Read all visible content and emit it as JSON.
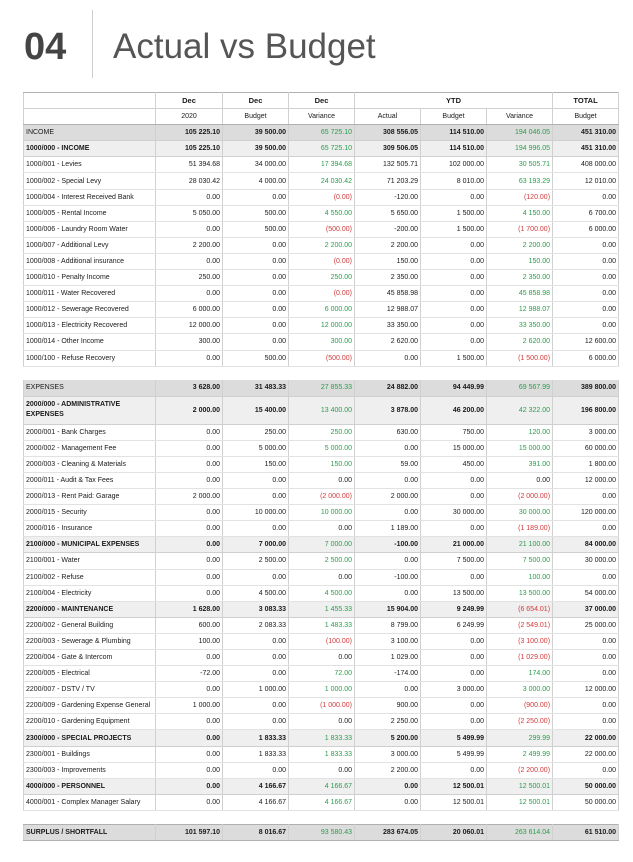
{
  "page": {
    "number": "04",
    "title": "Actual vs Budget"
  },
  "headers": {
    "top": [
      "",
      "Dec",
      "Dec",
      "Dec",
      "YTD",
      "TOTAL"
    ],
    "sub": [
      "",
      "2020",
      "Budget",
      "Variance",
      "Actual",
      "Budget",
      "Variance",
      "Budget"
    ]
  },
  "colors": {
    "positive_variance": "#2a9d4b",
    "negative_variance": "#d23a3a",
    "section_bg": "#dcdcdc"
  },
  "rows": [
    {
      "type": "section",
      "label": "INCOME",
      "v": [
        "105 225.10",
        "39 500.00",
        "65 725.10",
        "308 556.05",
        "114 510.00",
        "194 046.05",
        "451 310.00"
      ],
      "s": [
        "",
        "",
        "pos",
        "",
        "",
        "pos",
        ""
      ]
    },
    {
      "type": "group",
      "label": "1000/000 - INCOME",
      "v": [
        "105 225.10",
        "39 500.00",
        "65 725.10",
        "309 506.05",
        "114 510.00",
        "194 996.05",
        "451 310.00"
      ],
      "s": [
        "",
        "",
        "pos",
        "",
        "",
        "pos",
        ""
      ]
    },
    {
      "type": "line",
      "label": "1000/001 - Levies",
      "v": [
        "51 394.68",
        "34 000.00",
        "17 394.68",
        "132 505.71",
        "102 000.00",
        "30 505.71",
        "408 000.00"
      ],
      "s": [
        "",
        "",
        "pos",
        "",
        "",
        "pos",
        ""
      ]
    },
    {
      "type": "line",
      "label": "1000/002 - Special Levy",
      "v": [
        "28 030.42",
        "4 000.00",
        "24 030.42",
        "71 203.29",
        "8 010.00",
        "63 193.29",
        "12 010.00"
      ],
      "s": [
        "",
        "",
        "pos",
        "",
        "",
        "pos",
        ""
      ]
    },
    {
      "type": "line",
      "label": "1000/004 - Interest Received Bank",
      "v": [
        "0.00",
        "0.00",
        "(0.00)",
        "-120.00",
        "0.00",
        "(120.00)",
        "0.00"
      ],
      "s": [
        "",
        "",
        "neg",
        "",
        "",
        "neg",
        ""
      ]
    },
    {
      "type": "line",
      "label": "1000/005 - Rental Income",
      "v": [
        "5 050.00",
        "500.00",
        "4 550.00",
        "5 650.00",
        "1 500.00",
        "4 150.00",
        "6 700.00"
      ],
      "s": [
        "",
        "",
        "pos",
        "",
        "",
        "pos",
        ""
      ]
    },
    {
      "type": "line",
      "label": "1000/006 - Laundry Room Water",
      "v": [
        "0.00",
        "500.00",
        "(500.00)",
        "-200.00",
        "1 500.00",
        "(1 700.00)",
        "6 000.00"
      ],
      "s": [
        "",
        "",
        "neg",
        "",
        "",
        "neg",
        ""
      ]
    },
    {
      "type": "line",
      "label": "1000/007 - Additional Levy",
      "v": [
        "2 200.00",
        "0.00",
        "2 200.00",
        "2 200.00",
        "0.00",
        "2 200.00",
        "0.00"
      ],
      "s": [
        "",
        "",
        "pos",
        "",
        "",
        "pos",
        ""
      ]
    },
    {
      "type": "line",
      "label": "1000/008 - Additional insurance",
      "v": [
        "0.00",
        "0.00",
        "(0.00)",
        "150.00",
        "0.00",
        "150.00",
        "0.00"
      ],
      "s": [
        "",
        "",
        "neg",
        "",
        "",
        "pos",
        ""
      ]
    },
    {
      "type": "line",
      "label": "1000/010 - Penalty Income",
      "v": [
        "250.00",
        "0.00",
        "250.00",
        "2 350.00",
        "0.00",
        "2 350.00",
        "0.00"
      ],
      "s": [
        "",
        "",
        "pos",
        "",
        "",
        "pos",
        ""
      ]
    },
    {
      "type": "line",
      "label": "1000/011 - Water Recovered",
      "v": [
        "0.00",
        "0.00",
        "(0.00)",
        "45 858.98",
        "0.00",
        "45 858.98",
        "0.00"
      ],
      "s": [
        "",
        "",
        "neg",
        "",
        "",
        "pos",
        ""
      ]
    },
    {
      "type": "line",
      "label": "1000/012 - Sewerage Recovered",
      "v": [
        "6 000.00",
        "0.00",
        "6 000.00",
        "12 988.07",
        "0.00",
        "12 988.07",
        "0.00"
      ],
      "s": [
        "",
        "",
        "pos",
        "",
        "",
        "pos",
        ""
      ]
    },
    {
      "type": "line",
      "label": "1000/013 - Electricity Recovered",
      "v": [
        "12 000.00",
        "0.00",
        "12 000.00",
        "33 350.00",
        "0.00",
        "33 350.00",
        "0.00"
      ],
      "s": [
        "",
        "",
        "pos",
        "",
        "",
        "pos",
        ""
      ]
    },
    {
      "type": "line",
      "label": "1000/014 - Other Income",
      "v": [
        "300.00",
        "0.00",
        "300.00",
        "2 620.00",
        "0.00",
        "2 620.00",
        "12 600.00"
      ],
      "s": [
        "",
        "",
        "pos",
        "",
        "",
        "pos",
        ""
      ]
    },
    {
      "type": "line",
      "label": "1000/100 - Refuse Recovery",
      "v": [
        "0.00",
        "500.00",
        "(500.00)",
        "0.00",
        "1 500.00",
        "(1 500.00)",
        "6 000.00"
      ],
      "s": [
        "",
        "",
        "neg",
        "",
        "",
        "neg",
        ""
      ]
    },
    {
      "type": "spacer"
    },
    {
      "type": "section",
      "label": "EXPENSES",
      "v": [
        "3 628.00",
        "31 483.33",
        "27 855.33",
        "24 882.00",
        "94 449.99",
        "69 567.99",
        "389 800.00"
      ],
      "s": [
        "",
        "",
        "pos",
        "",
        "",
        "pos",
        ""
      ]
    },
    {
      "type": "group",
      "wrap": true,
      "label": "2000/000 - ADMINISTRATIVE EXPENSES",
      "v": [
        "2 000.00",
        "15 400.00",
        "13 400.00",
        "3 878.00",
        "46 200.00",
        "42 322.00",
        "196 800.00"
      ],
      "s": [
        "",
        "",
        "pos",
        "",
        "",
        "pos",
        ""
      ]
    },
    {
      "type": "line",
      "label": "2000/001 - Bank Charges",
      "v": [
        "0.00",
        "250.00",
        "250.00",
        "630.00",
        "750.00",
        "120.00",
        "3 000.00"
      ],
      "s": [
        "",
        "",
        "pos",
        "",
        "",
        "pos",
        ""
      ]
    },
    {
      "type": "line",
      "label": "2000/002 - Management Fee",
      "v": [
        "0.00",
        "5 000.00",
        "5 000.00",
        "0.00",
        "15 000.00",
        "15 000.00",
        "60 000.00"
      ],
      "s": [
        "",
        "",
        "pos",
        "",
        "",
        "pos",
        ""
      ]
    },
    {
      "type": "line",
      "label": "2000/003 - Cleaning & Materials",
      "v": [
        "0.00",
        "150.00",
        "150.00",
        "59.00",
        "450.00",
        "391.00",
        "1 800.00"
      ],
      "s": [
        "",
        "",
        "pos",
        "",
        "",
        "pos",
        ""
      ]
    },
    {
      "type": "line",
      "label": "2000/011 - Audit & Tax Fees",
      "v": [
        "0.00",
        "0.00",
        "0.00",
        "0.00",
        "0.00",
        "0.00",
        "12 000.00"
      ],
      "s": [
        "",
        "",
        "",
        "",
        "",
        "",
        ""
      ]
    },
    {
      "type": "line",
      "label": "2000/013 - Rent Paid: Garage",
      "v": [
        "2 000.00",
        "0.00",
        "(2 000.00)",
        "2 000.00",
        "0.00",
        "(2 000.00)",
        "0.00"
      ],
      "s": [
        "",
        "",
        "neg",
        "",
        "",
        "neg",
        ""
      ]
    },
    {
      "type": "line",
      "label": "2000/015 - Security",
      "v": [
        "0.00",
        "10 000.00",
        "10 000.00",
        "0.00",
        "30 000.00",
        "30 000.00",
        "120 000.00"
      ],
      "s": [
        "",
        "",
        "pos",
        "",
        "",
        "pos",
        ""
      ]
    },
    {
      "type": "line",
      "label": "2000/016 - Insurance",
      "v": [
        "0.00",
        "0.00",
        "0.00",
        "1 189.00",
        "0.00",
        "(1 189.00)",
        "0.00"
      ],
      "s": [
        "",
        "",
        "",
        "",
        "",
        "neg",
        ""
      ]
    },
    {
      "type": "group",
      "label": "2100/000 - MUNICIPAL EXPENSES",
      "v": [
        "0.00",
        "7 000.00",
        "7 000.00",
        "-100.00",
        "21 000.00",
        "21 100.00",
        "84 000.00"
      ],
      "s": [
        "",
        "",
        "pos",
        "",
        "",
        "pos",
        ""
      ]
    },
    {
      "type": "line",
      "label": "2100/001 - Water",
      "v": [
        "0.00",
        "2 500.00",
        "2 500.00",
        "0.00",
        "7 500.00",
        "7 500.00",
        "30 000.00"
      ],
      "s": [
        "",
        "",
        "pos",
        "",
        "",
        "pos",
        ""
      ]
    },
    {
      "type": "line",
      "label": "2100/002 - Refuse",
      "v": [
        "0.00",
        "0.00",
        "0.00",
        "-100.00",
        "0.00",
        "100.00",
        "0.00"
      ],
      "s": [
        "",
        "",
        "",
        "",
        "",
        "pos",
        ""
      ]
    },
    {
      "type": "line",
      "label": "2100/004 - Electricity",
      "v": [
        "0.00",
        "4 500.00",
        "4 500.00",
        "0.00",
        "13 500.00",
        "13 500.00",
        "54 000.00"
      ],
      "s": [
        "",
        "",
        "pos",
        "",
        "",
        "pos",
        ""
      ]
    },
    {
      "type": "group",
      "label": "2200/000 - MAINTENANCE",
      "v": [
        "1 628.00",
        "3 083.33",
        "1 455.33",
        "15 904.00",
        "9 249.99",
        "(6 654.01)",
        "37 000.00"
      ],
      "s": [
        "",
        "",
        "pos",
        "",
        "",
        "neg",
        ""
      ]
    },
    {
      "type": "line",
      "label": "2200/002 - General Building",
      "v": [
        "600.00",
        "2 083.33",
        "1 483.33",
        "8 799.00",
        "6 249.99",
        "(2 549.01)",
        "25 000.00"
      ],
      "s": [
        "",
        "",
        "pos",
        "",
        "",
        "neg",
        ""
      ]
    },
    {
      "type": "line",
      "label": "2200/003 - Sewerage & Plumbing",
      "v": [
        "100.00",
        "0.00",
        "(100.00)",
        "3 100.00",
        "0.00",
        "(3 100.00)",
        "0.00"
      ],
      "s": [
        "",
        "",
        "neg",
        "",
        "",
        "neg",
        ""
      ]
    },
    {
      "type": "line",
      "label": "2200/004 - Gate & Intercom",
      "v": [
        "0.00",
        "0.00",
        "0.00",
        "1 029.00",
        "0.00",
        "(1 029.00)",
        "0.00"
      ],
      "s": [
        "",
        "",
        "",
        "",
        "",
        "neg",
        ""
      ]
    },
    {
      "type": "line",
      "label": "2200/005 - Electrical",
      "v": [
        "-72.00",
        "0.00",
        "72.00",
        "-174.00",
        "0.00",
        "174.00",
        "0.00"
      ],
      "s": [
        "",
        "",
        "pos",
        "",
        "",
        "pos",
        ""
      ]
    },
    {
      "type": "line",
      "label": "2200/007 - DSTV / TV",
      "v": [
        "0.00",
        "1 000.00",
        "1 000.00",
        "0.00",
        "3 000.00",
        "3 000.00",
        "12 000.00"
      ],
      "s": [
        "",
        "",
        "pos",
        "",
        "",
        "pos",
        ""
      ]
    },
    {
      "type": "line",
      "label": "2200/009 - Gardening Expense General",
      "v": [
        "1 000.00",
        "0.00",
        "(1 000.00)",
        "900.00",
        "0.00",
        "(900.00)",
        "0.00"
      ],
      "s": [
        "",
        "",
        "neg",
        "",
        "",
        "neg",
        ""
      ]
    },
    {
      "type": "line",
      "label": "2200/010 - Gardening Equipment",
      "v": [
        "0.00",
        "0.00",
        "0.00",
        "2 250.00",
        "0.00",
        "(2 250.00)",
        "0.00"
      ],
      "s": [
        "",
        "",
        "",
        "",
        "",
        "neg",
        ""
      ]
    },
    {
      "type": "group",
      "label": "2300/000 - SPECIAL PROJECTS",
      "v": [
        "0.00",
        "1 833.33",
        "1 833.33",
        "5 200.00",
        "5 499.99",
        "299.99",
        "22 000.00"
      ],
      "s": [
        "",
        "",
        "pos",
        "",
        "",
        "pos",
        ""
      ]
    },
    {
      "type": "line",
      "label": "2300/001 - Buildings",
      "v": [
        "0.00",
        "1 833.33",
        "1 833.33",
        "3 000.00",
        "5 499.99",
        "2 499.99",
        "22 000.00"
      ],
      "s": [
        "",
        "",
        "pos",
        "",
        "",
        "pos",
        ""
      ]
    },
    {
      "type": "line",
      "label": "2300/003 - Improvements",
      "v": [
        "0.00",
        "0.00",
        "0.00",
        "2 200.00",
        "0.00",
        "(2 200.00)",
        "0.00"
      ],
      "s": [
        "",
        "",
        "",
        "",
        "",
        "neg",
        ""
      ]
    },
    {
      "type": "group",
      "label": "4000/000 - PERSONNEL",
      "v": [
        "0.00",
        "4 166.67",
        "4 166.67",
        "0.00",
        "12 500.01",
        "12 500.01",
        "50 000.00"
      ],
      "s": [
        "",
        "",
        "pos",
        "",
        "",
        "pos",
        ""
      ]
    },
    {
      "type": "line",
      "label": "4000/001 - Complex Manager Salary",
      "v": [
        "0.00",
        "4 166.67",
        "4 166.67",
        "0.00",
        "12 500.01",
        "12 500.01",
        "50 000.00"
      ],
      "s": [
        "",
        "",
        "pos",
        "",
        "",
        "pos",
        ""
      ]
    },
    {
      "type": "spacer"
    },
    {
      "type": "total",
      "label": "SURPLUS / SHORTFALL",
      "v": [
        "101 597.10",
        "8 016.67",
        "93 580.43",
        "283 674.05",
        "20 060.01",
        "263 614.04",
        "61 510.00"
      ],
      "s": [
        "",
        "",
        "pos",
        "",
        "",
        "pos",
        ""
      ]
    }
  ]
}
